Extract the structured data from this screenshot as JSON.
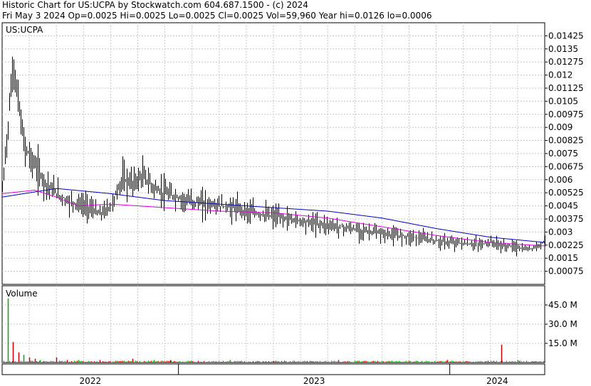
{
  "header": {
    "line1": "Historic Chart for US:UCPA by Stockwatch.com 604.687.1500 - (c) 2024",
    "line2": "Fri May  3 2024   Op=0.0025   Hi=0.0025   Lo=0.0025   Cl=0.0025   Vol=59,960   Year hi=0.0126   lo=0.0006"
  },
  "chart_data": [
    {
      "type": "bar",
      "subtype": "ohlc",
      "symbol_label": "US:UCPA",
      "y_ticks": [
        "0.01425",
        "0.0135",
        "0.01275",
        "0.012",
        "0.01125",
        "0.0105",
        "0.00975",
        "0.009",
        "0.00825",
        "0.0075",
        "0.00675",
        "0.006",
        "0.00525",
        "0.0045",
        "0.00375",
        "0.003",
        "0.00225",
        "0.0015",
        "0.00075"
      ],
      "ylim": [
        0,
        0.015
      ],
      "x_labels": [
        "2022",
        "2023",
        "2024"
      ],
      "grid": true,
      "series": [
        {
          "name": "price",
          "values": [
            [
              0,
              0.0054
            ],
            [
              2,
              0.0126
            ],
            [
              4,
              0.008
            ],
            [
              6,
              0.0068
            ],
            [
              8,
              0.0058
            ],
            [
              10,
              0.0052
            ],
            [
              12,
              0.0048
            ],
            [
              14,
              0.0046
            ],
            [
              16,
              0.0044
            ],
            [
              18,
              0.004
            ],
            [
              20,
              0.0045
            ],
            [
              22,
              0.006
            ],
            [
              24,
              0.0058
            ],
            [
              26,
              0.0062
            ],
            [
              28,
              0.0055
            ],
            [
              30,
              0.0052
            ],
            [
              32,
              0.005
            ],
            [
              34,
              0.0048
            ],
            [
              36,
              0.0047
            ],
            [
              38,
              0.0046
            ],
            [
              40,
              0.0045
            ],
            [
              42,
              0.0044
            ],
            [
              44,
              0.0043
            ],
            [
              46,
              0.0041
            ],
            [
              48,
              0.004
            ],
            [
              50,
              0.0039
            ],
            [
              52,
              0.0038
            ],
            [
              54,
              0.0037
            ],
            [
              56,
              0.0036
            ],
            [
              58,
              0.0035
            ],
            [
              60,
              0.0034
            ],
            [
              62,
              0.0033
            ],
            [
              64,
              0.0032
            ],
            [
              66,
              0.0031
            ],
            [
              68,
              0.003
            ],
            [
              70,
              0.0029
            ],
            [
              72,
              0.0028
            ],
            [
              74,
              0.0028
            ],
            [
              76,
              0.0027
            ],
            [
              78,
              0.0026
            ],
            [
              80,
              0.0025
            ],
            [
              82,
              0.0024
            ],
            [
              84,
              0.0024
            ],
            [
              86,
              0.0023
            ],
            [
              88,
              0.0023
            ],
            [
              90,
              0.0024
            ],
            [
              92,
              0.0022
            ],
            [
              94,
              0.0022
            ],
            [
              96,
              0.002
            ],
            [
              98,
              0.0021
            ],
            [
              100,
              0.0025
            ]
          ]
        },
        {
          "name": "ma_long",
          "values": [
            [
              0,
              0.005
            ],
            [
              10,
              0.0055
            ],
            [
              20,
              0.0052
            ],
            [
              30,
              0.0048
            ],
            [
              40,
              0.0046
            ],
            [
              50,
              0.0044
            ],
            [
              60,
              0.0042
            ],
            [
              70,
              0.0038
            ],
            [
              80,
              0.0032
            ],
            [
              90,
              0.0027
            ],
            [
              100,
              0.0024
            ]
          ]
        },
        {
          "name": "ma_short",
          "values": [
            [
              0,
              0.0052
            ],
            [
              6,
              0.0054
            ],
            [
              10,
              0.005
            ],
            [
              14,
              0.0045
            ],
            [
              20,
              0.0046
            ],
            [
              30,
              0.0044
            ],
            [
              40,
              0.0042
            ],
            [
              50,
              0.0041
            ],
            [
              60,
              0.0038
            ],
            [
              70,
              0.0033
            ],
            [
              80,
              0.0028
            ],
            [
              90,
              0.0024
            ],
            [
              100,
              0.0022
            ]
          ]
        }
      ]
    },
    {
      "type": "bar",
      "title": "Volume",
      "y_ticks": [
        "45.0 M",
        "30.0 M",
        "15.0 M"
      ],
      "ylim": [
        0,
        60
      ],
      "values_millions": [
        [
          1,
          50
        ],
        [
          2,
          16
        ],
        [
          3,
          8
        ],
        [
          4,
          6
        ],
        [
          5,
          4
        ],
        [
          6,
          3
        ],
        [
          7,
          2
        ],
        [
          10,
          4
        ],
        [
          12,
          2
        ],
        [
          14,
          2
        ],
        [
          18,
          2
        ],
        [
          24,
          3
        ],
        [
          28,
          2
        ],
        [
          31,
          2
        ],
        [
          35,
          1
        ],
        [
          42,
          2
        ],
        [
          50,
          1
        ],
        [
          62,
          2
        ],
        [
          70,
          1
        ],
        [
          82,
          2
        ],
        [
          92,
          14
        ],
        [
          95,
          2
        ]
      ],
      "colors": {
        "up": "#00aa00",
        "down": "#cc0000"
      }
    }
  ],
  "colors": {
    "ohlc": "#000000",
    "ma_long": "#0000c8",
    "ma_short": "#e000e0",
    "grid": "#c8c8c8",
    "frame": "#000000"
  }
}
